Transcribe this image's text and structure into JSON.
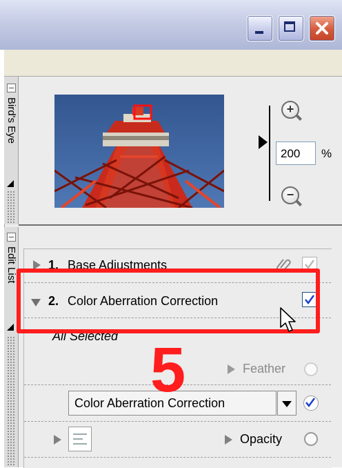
{
  "window": {
    "controls": [
      "minimize-icon",
      "maximize-icon",
      "close-icon"
    ]
  },
  "birds_eye": {
    "tab_label": "Bird's Eye",
    "zoom_value": "200",
    "zoom_unit": "%"
  },
  "edit_list": {
    "tab_label": "Edit List",
    "step1_number": "1.",
    "step1_label": "Base Adjustments",
    "step2_number": "2.",
    "step2_label": "Color Aberration Correction",
    "selection_label": "All Selected",
    "feather_label": "Feather",
    "dropdown_value": "Color Aberration Correction",
    "opacity_label": "Opacity"
  },
  "annotation": {
    "step_number": "5"
  },
  "colors": {
    "annotation_red": "#ff1d1d",
    "check_blue": "#1a3fd1",
    "titlebar": "#c4cbe4"
  }
}
